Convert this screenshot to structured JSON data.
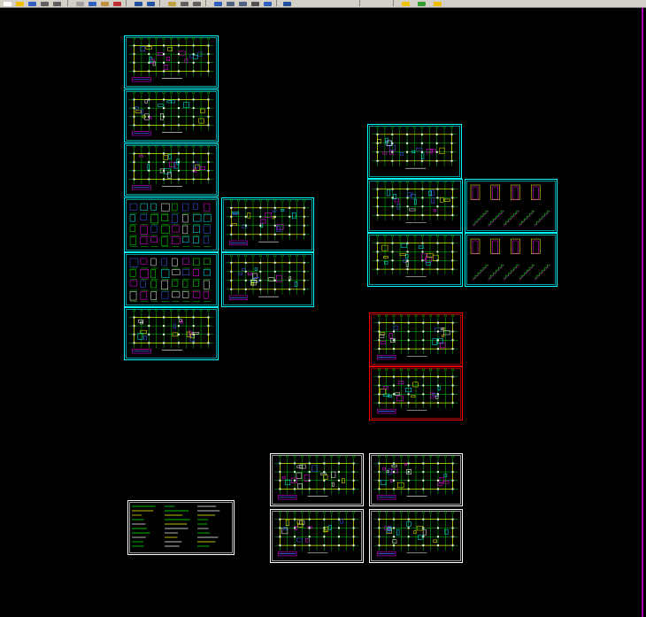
{
  "toolbar": {
    "buttons": [
      {
        "name": "new-icon",
        "color": "#ffffff"
      },
      {
        "name": "open-icon",
        "color": "#f0c000"
      },
      {
        "name": "save-icon",
        "color": "#3060c0"
      },
      {
        "name": "print-icon",
        "color": "#606060"
      },
      {
        "name": "plot-preview-icon",
        "color": "#606060"
      },
      {
        "name": "cut-icon",
        "color": "#a0a0a0"
      },
      {
        "name": "copy-icon",
        "color": "#3060c0"
      },
      {
        "name": "paste-icon",
        "color": "#c09040"
      },
      {
        "name": "match-properties-icon",
        "color": "#c03030"
      },
      {
        "name": "undo-icon",
        "color": "#2050a0"
      },
      {
        "name": "redo-icon",
        "color": "#2050a0"
      },
      {
        "name": "pan-icon",
        "color": "#c0a040"
      },
      {
        "name": "zoom-realtime-icon",
        "color": "#606060"
      },
      {
        "name": "zoom-window-icon",
        "color": "#606060"
      },
      {
        "name": "properties-icon",
        "color": "#3060c0"
      },
      {
        "name": "design-center-icon",
        "color": "#506080"
      },
      {
        "name": "tool-palettes-icon",
        "color": "#506080"
      },
      {
        "name": "calculator-icon",
        "color": "#505050"
      },
      {
        "name": "sheet-set-icon",
        "color": "#3060c0"
      },
      {
        "name": "help-icon",
        "color": "#2050a0"
      },
      {
        "name": "layer-icon",
        "color": "#f0c000"
      },
      {
        "name": "layer-state-icon",
        "color": "#30a030"
      },
      {
        "name": "color-icon",
        "color": "#f0c000"
      }
    ]
  },
  "colors": {
    "background": "#000000",
    "cyan_border": "#00ffff",
    "red_border": "#ff0000",
    "white_border": "#ffffff",
    "magenta": "#ff00ff",
    "green": "#00ff00",
    "yellow": "#ffff00",
    "blue": "#4060ff"
  },
  "sheets": [
    {
      "id": "s1",
      "group": "structure-a",
      "border": "#00ffff",
      "type": "plan"
    },
    {
      "id": "s2",
      "group": "structure-a",
      "border": "#00ffff",
      "type": "plan"
    },
    {
      "id": "s3",
      "group": "structure-a",
      "border": "#00ffff",
      "type": "plan"
    },
    {
      "id": "s4",
      "group": "structure-a",
      "border": "#00ffff",
      "type": "details"
    },
    {
      "id": "s5",
      "group": "structure-a",
      "border": "#00ffff",
      "type": "details"
    },
    {
      "id": "s6",
      "group": "structure-a",
      "border": "#00ffff",
      "type": "plan"
    },
    {
      "id": "s7",
      "group": "structure-a",
      "border": "#00ffff",
      "type": "plan"
    },
    {
      "id": "s8",
      "group": "structure-a",
      "border": "#00ffff",
      "type": "plan"
    },
    {
      "id": "s9",
      "group": "structure-b",
      "border": "#00ffff",
      "type": "plan"
    },
    {
      "id": "s10",
      "group": "structure-b",
      "border": "#00ffff",
      "type": "plan"
    },
    {
      "id": "s11",
      "group": "structure-b",
      "border": "#00ffff",
      "type": "stairs"
    },
    {
      "id": "s12",
      "group": "structure-b",
      "border": "#00ffff",
      "type": "plan"
    },
    {
      "id": "s13",
      "group": "structure-b",
      "border": "#00ffff",
      "type": "stairs"
    },
    {
      "id": "s14",
      "group": "services",
      "border": "#ff0000",
      "type": "plan"
    },
    {
      "id": "s15",
      "group": "services",
      "border": "#ff0000",
      "type": "plan"
    },
    {
      "id": "s16",
      "group": "notes",
      "border": "#ffffff",
      "type": "notes"
    },
    {
      "id": "s17",
      "group": "electrical",
      "border": "#ffffff",
      "type": "plan"
    },
    {
      "id": "s18",
      "group": "electrical",
      "border": "#ffffff",
      "type": "plan"
    },
    {
      "id": "s19",
      "group": "electrical",
      "border": "#ffffff",
      "type": "plan"
    },
    {
      "id": "s20",
      "group": "electrical",
      "border": "#ffffff",
      "type": "plan"
    }
  ]
}
